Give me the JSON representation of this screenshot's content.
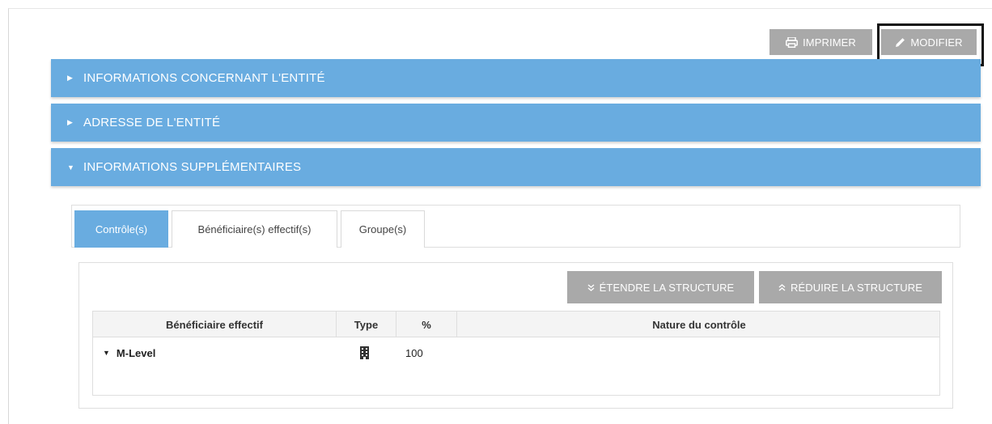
{
  "toolbar": {
    "print_label": "IMPRIMER",
    "edit_label": "MODIFIER"
  },
  "accordion": [
    {
      "label": "INFORMATIONS CONCERNANT L'ENTITÉ",
      "expanded": false
    },
    {
      "label": "ADRESSE DE L'ENTITÉ",
      "expanded": false
    },
    {
      "label": "INFORMATIONS SUPPLÉMENTAIRES",
      "expanded": true
    }
  ],
  "tabs": [
    {
      "label": "Contrôle(s)",
      "active": true
    },
    {
      "label": "Bénéficiaire(s) effectif(s)",
      "active": false
    },
    {
      "label": "Groupe(s)",
      "active": false
    }
  ],
  "structure_actions": {
    "expand_label": "ÉTENDRE LA STRUCTURE",
    "collapse_label": "RÉDUIRE LA STRUCTURE"
  },
  "table": {
    "columns": [
      "Bénéficiaire effectif",
      "Type",
      "%",
      "Nature du contrôle"
    ],
    "rows": [
      {
        "name": "M-Level",
        "type_icon": "building-icon",
        "percent": "100",
        "nature": ""
      }
    ]
  },
  "colors": {
    "accent": "#69ace0",
    "button_grey": "#a9a9a9",
    "highlight": "#111111"
  }
}
